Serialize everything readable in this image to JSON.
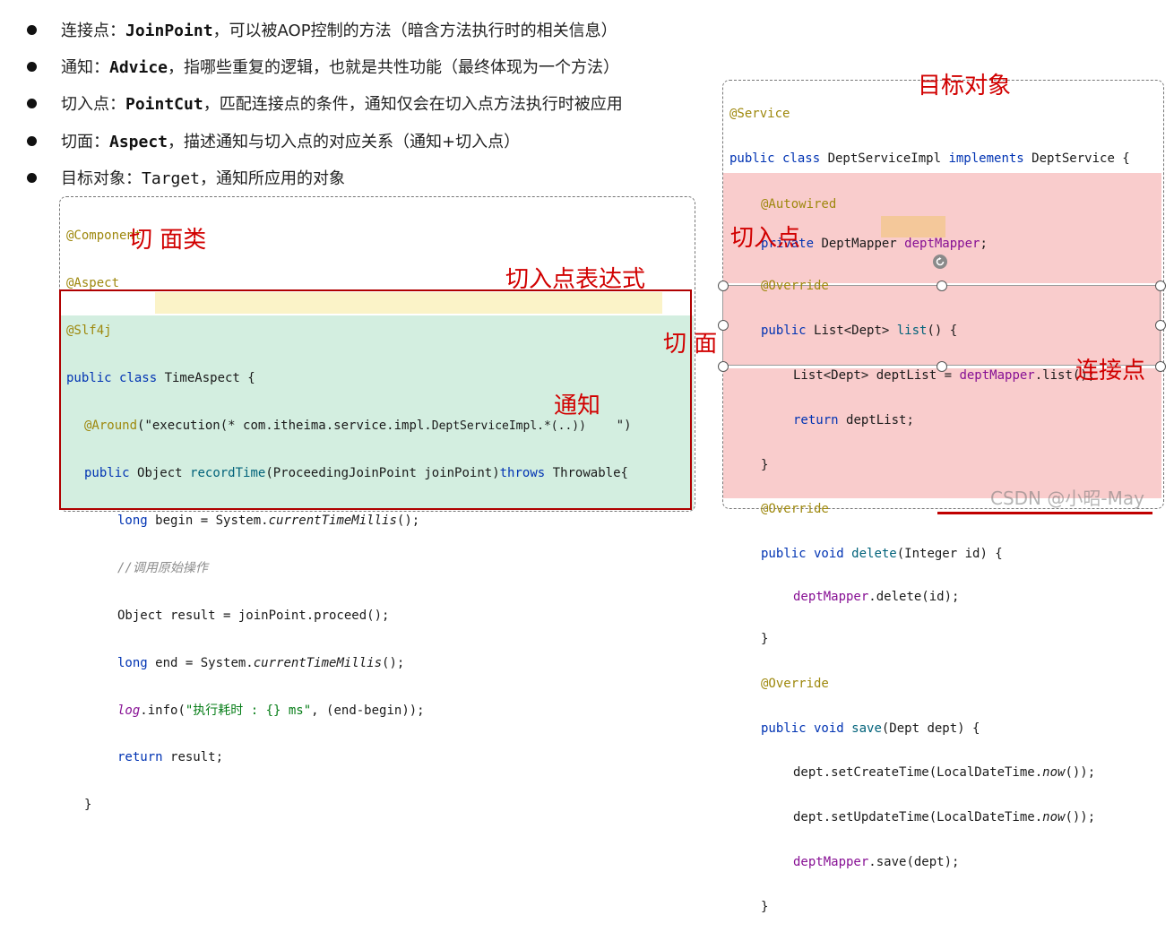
{
  "bullets": [
    {
      "term_prefix": "连接点：",
      "term": "JoinPoint",
      "desc": "，可以被AOP控制的方法（暗含方法执行时的相关信息）"
    },
    {
      "term_prefix": "通知：",
      "term": "Advice",
      "desc": "，指哪些重复的逻辑，也就是共性功能（最终体现为一个方法）"
    },
    {
      "term_prefix": "切入点：",
      "term": "PointCut",
      "desc": "，匹配连接点的条件，通知仅会在切入点方法执行时被应用"
    },
    {
      "term_prefix": "切面：",
      "term": "Aspect",
      "desc": "，描述通知与切入点的对应关系（通知+切入点）"
    },
    {
      "term_prefix": "目标对象：",
      "term": "Target",
      "desc": "，通知所应用的对象"
    }
  ],
  "left_code": {
    "l1": "@Component",
    "l2": "@Aspect",
    "l3": "@Slf4j",
    "l4_kw": "public class ",
    "l4_name": "TimeAspect {",
    "l5_ann": "@Around",
    "l5_open": "(\"",
    "l5_expr": "execution(* com.itheima.service.impl.",
    "l5_expr_small": "DeptServiceImpl.*(..))",
    "l5_close": "\")",
    "l6_kw": "public ",
    "l6_type": "Object ",
    "l6_fn": "recordTime",
    "l6_params": "(ProceedingJoinPoint joinPoint)",
    "l6_throws": "throws ",
    "l6_ex": "Throwable{",
    "l7_kw": "long ",
    "l7_rest": "begin = System.",
    "l7_it": "currentTimeMillis",
    "l7_end": "();",
    "l8": "//调用原始操作",
    "l9": "Object result = joinPoint.proceed();",
    "l10_kw": "long ",
    "l10_rest": "end = System.",
    "l10_it": "currentTimeMillis",
    "l10_end": "();",
    "l11_it": "log",
    "l11_mid": ".info(",
    "l11_str": "\"执行耗时 : {} ms\"",
    "l11_end": ", (end-begin));",
    "l12_kw": "return ",
    "l12_rest": "result;",
    "l13": "}"
  },
  "right_code": {
    "r1": "@Service",
    "r2_kw1": "public class ",
    "r2_name": "DeptServiceImpl ",
    "r2_kw2": "implements ",
    "r2_iface": "DeptService {",
    "r3": "@Autowired",
    "r4_kw": "private ",
    "r4_type": "DeptMapper ",
    "r4_fld": "deptMapper",
    "r4_end": ";",
    "r5": "@Override",
    "r6_kw": "public ",
    "r6_rest": "List<Dept> ",
    "r6_fn": "list",
    "r6_end": "() {",
    "r7_pre": "List<Dept> ",
    "r7_var": "deptList",
    "r7_eq": " = ",
    "r7_fld": "deptMapper",
    "r7_end": ".list();",
    "r8_kw": "return ",
    "r8_rest": "deptList;",
    "r9": "}",
    "r10": "@Override",
    "r11_kw": "public void ",
    "r11_fn": "delete",
    "r11_end": "(Integer id) {",
    "r12_fld": "deptMapper",
    "r12_end": ".delete(id);",
    "r13": "}",
    "r14": "@Override",
    "r15_kw": "public void ",
    "r15_fn": "save",
    "r15_end": "(Dept dept) {",
    "r16_pre": "dept.setCreateTime(LocalDateTime.",
    "r16_it": "now",
    "r16_end": "());",
    "r17_pre": "dept.setUpdateTime(LocalDateTime.",
    "r17_it": "now",
    "r17_end": "());",
    "r18_fld": "deptMapper",
    "r18_end": ".save(dept);",
    "r19": "}"
  },
  "labels": {
    "aspect_class": "切 面类",
    "pointcut_expr": "切入点表达式",
    "aspect": "切 面",
    "advice": "通知",
    "target": "目标对象",
    "pointcut": "切入点",
    "joinpoint": "连接点"
  },
  "watermark": "CSDN @小昭-May",
  "colors": {
    "pink": "#f9cccc",
    "green": "#d3eee0",
    "yellow_highlight": "#fbf3c8",
    "red_border": "#b00000",
    "label_red": "#d10000"
  }
}
